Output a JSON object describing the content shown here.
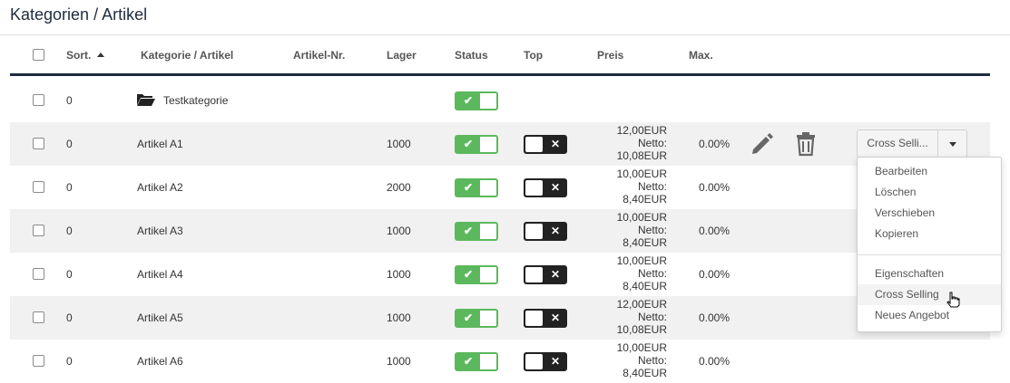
{
  "page": {
    "title": "Kategorien / Artikel"
  },
  "columns": {
    "sort": "Sort.",
    "name": "Kategorie / Artikel",
    "article_no": "Artikel-Nr.",
    "stock": "Lager",
    "status": "Status",
    "top": "Top",
    "price": "Preis",
    "max": "Max."
  },
  "category": {
    "sort": "0",
    "name": "Testkategorie",
    "status_on": true
  },
  "articles": [
    {
      "sort": "0",
      "name": "Artikel A1",
      "stock": "1000",
      "price_line1": "12,00EUR",
      "price_line2": "Netto:",
      "price_line3": "10,08EUR",
      "max": "0.00%"
    },
    {
      "sort": "0",
      "name": "Artikel A2",
      "stock": "2000",
      "price_line1": "10,00EUR",
      "price_line2": "Netto:",
      "price_line3": "8,40EUR",
      "max": "0.00%"
    },
    {
      "sort": "0",
      "name": "Artikel A3",
      "stock": "1000",
      "price_line1": "10,00EUR",
      "price_line2": "Netto:",
      "price_line3": "8,40EUR",
      "max": "0.00%"
    },
    {
      "sort": "0",
      "name": "Artikel A4",
      "stock": "1000",
      "price_line1": "10,00EUR",
      "price_line2": "Netto:",
      "price_line3": "8,40EUR",
      "max": "0.00%"
    },
    {
      "sort": "0",
      "name": "Artikel A5",
      "stock": "1000",
      "price_line1": "12,00EUR",
      "price_line2": "Netto:",
      "price_line3": "10,08EUR",
      "max": "0.00%"
    },
    {
      "sort": "0",
      "name": "Artikel A6",
      "stock": "1000",
      "price_line1": "10,00EUR",
      "price_line2": "Netto:",
      "price_line3": "8,40EUR",
      "max": "0.00%"
    }
  ],
  "actions": {
    "cross_selling_button": "Cross Selli..."
  },
  "dropdown": {
    "items": [
      "Bearbeiten",
      "Löschen",
      "Verschieben",
      "Kopieren"
    ],
    "items2": [
      "Eigenschaften",
      "Cross Selling",
      "Neues Angebot"
    ],
    "hovered": "Cross Selling"
  },
  "icons": {
    "status_on": "check-icon",
    "top_off": "x-icon",
    "edit": "pencil-icon",
    "delete": "trash-icon",
    "category": "folder-open-icon"
  },
  "colors": {
    "toggle_on": "#5cb85c",
    "toggle_off": "#222222",
    "header_rule": "#1f2b3d"
  }
}
